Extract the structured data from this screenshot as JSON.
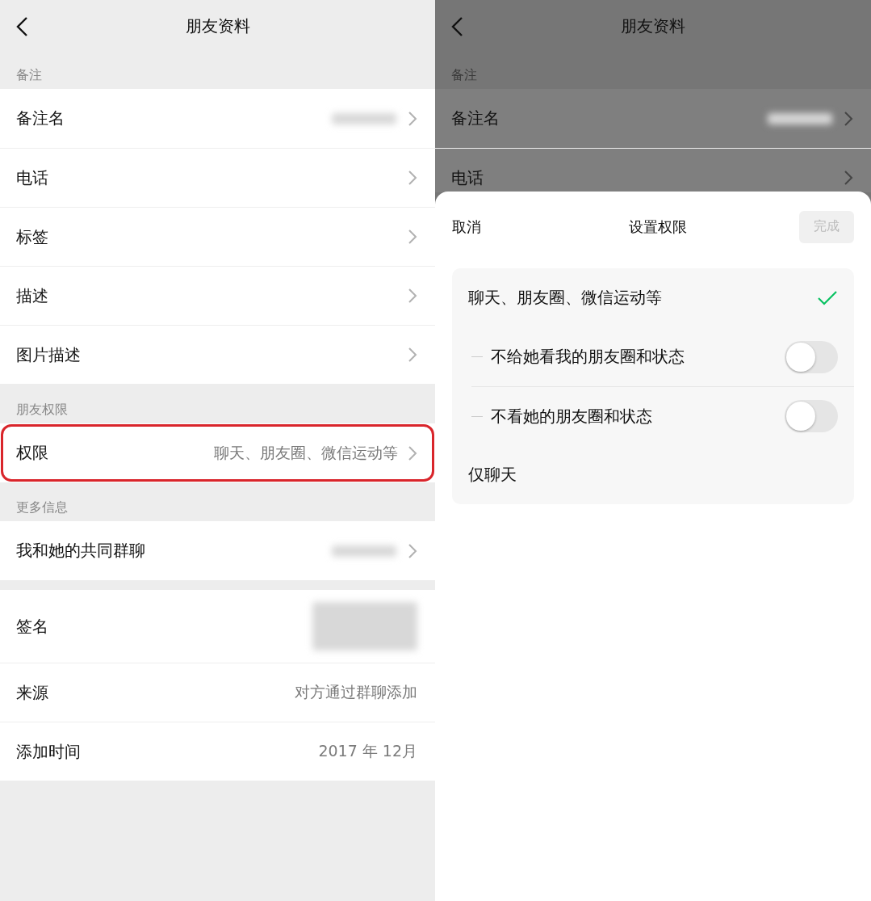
{
  "left": {
    "title": "朋友资料",
    "sections": [
      {
        "label": "备注",
        "rows": [
          {
            "label": "备注名",
            "kind": "blurred",
            "highlighted": false
          },
          {
            "label": "电话",
            "kind": "plain",
            "highlighted": false
          },
          {
            "label": "标签",
            "kind": "plain",
            "highlighted": false
          },
          {
            "label": "描述",
            "kind": "plain",
            "highlighted": false
          },
          {
            "label": "图片描述",
            "kind": "plain",
            "highlighted": false
          }
        ]
      },
      {
        "label": "朋友权限",
        "rows": [
          {
            "label": "权限",
            "kind": "plain",
            "value": "聊天、朋友圈、微信运动等",
            "highlighted": true
          }
        ]
      },
      {
        "label": "更多信息",
        "rows": [
          {
            "label": "我和她的共同群聊",
            "kind": "blurred",
            "highlighted": false
          }
        ]
      },
      {
        "rows": [
          {
            "label": "签名",
            "kind": "blurred-tall",
            "highlighted": false
          },
          {
            "label": "来源",
            "kind": "info",
            "value": "对方通过群聊添加",
            "highlighted": false
          },
          {
            "label": "添加时间",
            "kind": "info",
            "value": "2017 年 12月",
            "highlighted": false
          }
        ]
      }
    ]
  },
  "right": {
    "title": "朋友资料",
    "section_label": "备注",
    "rows": [
      {
        "label": "备注名",
        "kind": "blurred"
      },
      {
        "label": "电话",
        "kind": "plain"
      }
    ],
    "sheet": {
      "cancel": "取消",
      "title": "设置权限",
      "done": {
        "label": "完成",
        "disabled": true
      },
      "options": [
        {
          "label": "聊天、朋友圈、微信运动等",
          "kind": "choice",
          "selected": true
        },
        {
          "label": "不给她看我的朋友圈和状态",
          "kind": "toggle",
          "on": false
        },
        {
          "label": "不看她的朋友圈和状态",
          "kind": "toggle",
          "on": false
        },
        {
          "label": "仅聊天",
          "kind": "choice",
          "selected": false
        }
      ]
    }
  }
}
